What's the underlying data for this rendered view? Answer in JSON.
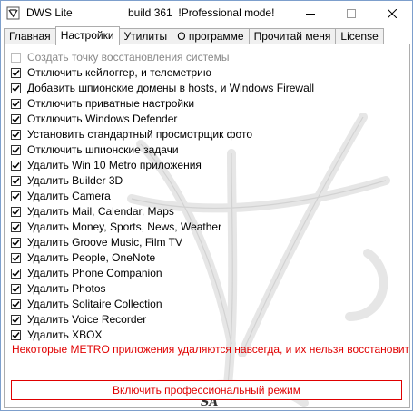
{
  "window": {
    "title": "DWS Lite",
    "subtitle": "build 361  !Professional mode!"
  },
  "tabs": [
    {
      "label": "Главная"
    },
    {
      "label": "Настройки"
    },
    {
      "label": "Утилиты"
    },
    {
      "label": "О программе"
    },
    {
      "label": "Прочитай меня"
    },
    {
      "label": "License"
    }
  ],
  "active_tab": "Настройки",
  "options": [
    {
      "label": "Создать точку восстановления системы",
      "checked": false,
      "disabled": true
    },
    {
      "label": "Отключить кейлоггер, и телеметрию",
      "checked": true
    },
    {
      "label": "Добавить шпионские домены в hosts, и Windows Firewall",
      "checked": true
    },
    {
      "label": "Отключить приватные настройки",
      "checked": true
    },
    {
      "label": "Отключить Windows Defender",
      "checked": true
    },
    {
      "label": "Установить стандартный просмотрщик фото",
      "checked": true
    },
    {
      "label": "Отключить шпионские задачи",
      "checked": true
    },
    {
      "label": "Удалить Win 10 Metro приложения",
      "checked": true
    },
    {
      "label": "Удалить Builder 3D",
      "checked": true
    },
    {
      "label": "Удалить Camera",
      "checked": true
    },
    {
      "label": "Удалить Mail, Calendar, Maps",
      "checked": true
    },
    {
      "label": "Удалить Money, Sports, News, Weather",
      "checked": true
    },
    {
      "label": "Удалить Groove Music, Film TV",
      "checked": true
    },
    {
      "label": "Удалить People, OneNote",
      "checked": true
    },
    {
      "label": "Удалить Phone Companion",
      "checked": true
    },
    {
      "label": "Удалить Photos",
      "checked": true
    },
    {
      "label": "Удалить Solitaire Collection",
      "checked": true
    },
    {
      "label": "Удалить Voice Recorder",
      "checked": true
    },
    {
      "label": "Удалить XBOX",
      "checked": true
    }
  ],
  "warning": "Некоторые METRO приложения удаляются навсегда, и их нельзя восстановить",
  "pro_button": "Включить профессиональный режим",
  "watermark_text": "SA",
  "colors": {
    "warning": "#e00000",
    "check": "#000000"
  }
}
